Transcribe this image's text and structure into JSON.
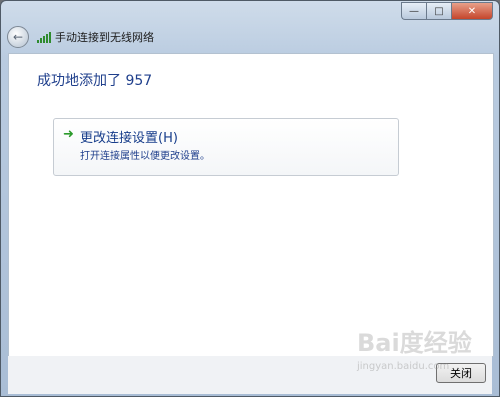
{
  "window": {
    "title": "手动连接到无线网络",
    "controls": {
      "minimize": "—",
      "maximize": "□",
      "close": "✕"
    }
  },
  "icons": {
    "back": "back-arrow-icon",
    "wifi": "wifi-signal-icon",
    "option": "green-arrow-icon"
  },
  "content": {
    "headline": "成功地添加了 957",
    "option": {
      "title": "更改连接设置(H)",
      "description": "打开连接属性以便更改设置。"
    }
  },
  "footer": {
    "close_button": "关闭"
  },
  "watermark": {
    "text": "Bai度经验",
    "url": "jingyan.baidu.com"
  }
}
